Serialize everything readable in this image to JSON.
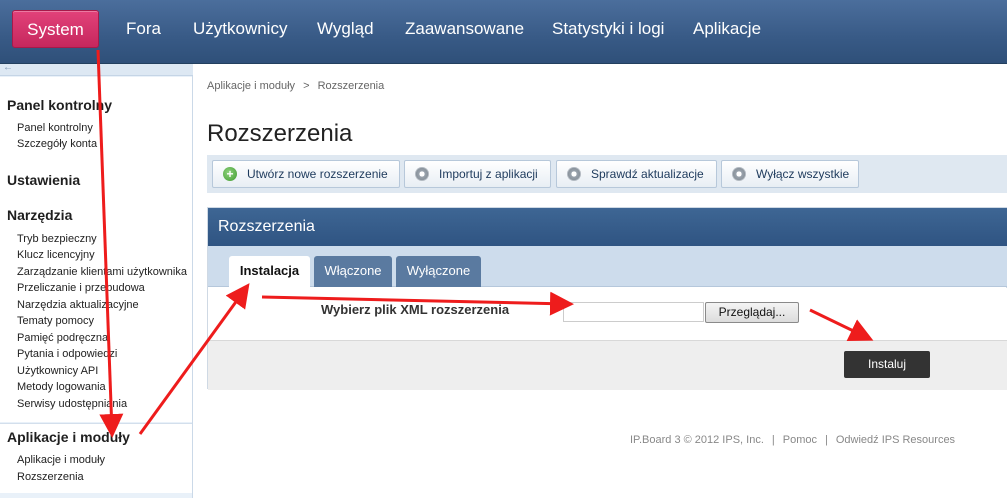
{
  "nav": {
    "items": [
      {
        "label": "System",
        "active": true
      },
      {
        "label": "Fora"
      },
      {
        "label": "Użytkownicy"
      },
      {
        "label": "Wygląd"
      },
      {
        "label": "Zaawansowane"
      },
      {
        "label": "Statystyki i logi"
      },
      {
        "label": "Aplikacje"
      }
    ]
  },
  "sidebar": {
    "toggle_icon": "←",
    "sections": [
      {
        "title": "Panel kontrolny",
        "links": [
          "Panel kontrolny",
          "Szczegóły konta"
        ]
      },
      {
        "title": "Ustawienia",
        "links": []
      },
      {
        "title": "Narzędzia",
        "links": [
          "Tryb bezpieczny",
          "Klucz licencyjny",
          "Zarządzanie klientami użytkownika",
          "Przeliczanie i przebudowa",
          "Narzędzia aktualizacyjne",
          "Tematy pomocy",
          "Pamięć podręczna",
          "Pytania i odpowiedzi",
          "Użytkownicy API",
          "Metody logowania",
          "Serwisy udostępniania"
        ]
      },
      {
        "title": "Aplikacje i moduły",
        "links": [
          "Aplikacje i moduły",
          "Rozszerzenia"
        ]
      }
    ]
  },
  "breadcrumb": {
    "parent": "Aplikacje i moduły",
    "separator": ">",
    "current": "Rozszerzenia"
  },
  "page_title": "Rozszerzenia",
  "toolbar": {
    "buttons": [
      {
        "label": "Utwórz nowe rozszerzenie",
        "icon": "plus-circle-icon"
      },
      {
        "label": "Importuj z aplikacji",
        "icon": "gear-icon"
      },
      {
        "label": "Sprawdź aktualizacje",
        "icon": "gear-icon"
      },
      {
        "label": "Wyłącz wszystkie",
        "icon": "gear-icon"
      }
    ]
  },
  "panel": {
    "title": "Rozszerzenia",
    "tabs": [
      {
        "label": "Instalacja",
        "active": true
      },
      {
        "label": "Włączone"
      },
      {
        "label": "Wyłączone"
      }
    ],
    "file_label": "Wybierz plik XML rozszerzenia",
    "file_value": "",
    "browse_label": "Przeglądaj...",
    "install_label": "Instaluj"
  },
  "footer": {
    "copyright": "IP.Board 3 © 2012 IPS, Inc.",
    "sep": "|",
    "help": "Pomoc",
    "resources": "Odwiedź IPS Resources"
  },
  "colors": {
    "nav_bg": "#3d6391",
    "nav_active": "#d7346c",
    "panel_head": "#34598a",
    "annotation_arrow": "#ee1c1c"
  }
}
